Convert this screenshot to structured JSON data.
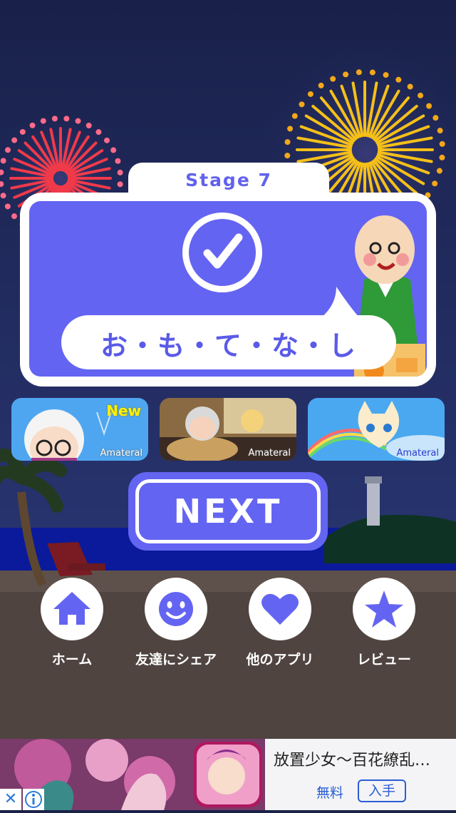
{
  "stage": {
    "label": "Stage 7"
  },
  "result": {
    "message": "お・も・て・な・し"
  },
  "promos": [
    {
      "brand": "Amateral",
      "badge": "New"
    },
    {
      "brand": "Amateral"
    },
    {
      "brand": "Amateral"
    }
  ],
  "next_button": {
    "label": "NEXT"
  },
  "nav": {
    "home": "ホーム",
    "share": "友達にシェア",
    "other_apps": "他のアプリ",
    "review": "レビュー"
  },
  "ad": {
    "title": "放置少女〜百花繚乱…",
    "price": "無料",
    "get_label": "入手",
    "close_symbol": "✕"
  },
  "colors": {
    "accent": "#6464f2",
    "sky": "#1a2247",
    "sand": "#4f4440",
    "sea": "#0a1a9a"
  },
  "icons": {
    "home": "home-icon",
    "share": "smiley-icon",
    "other_apps": "heart-icon",
    "review": "star-icon"
  }
}
